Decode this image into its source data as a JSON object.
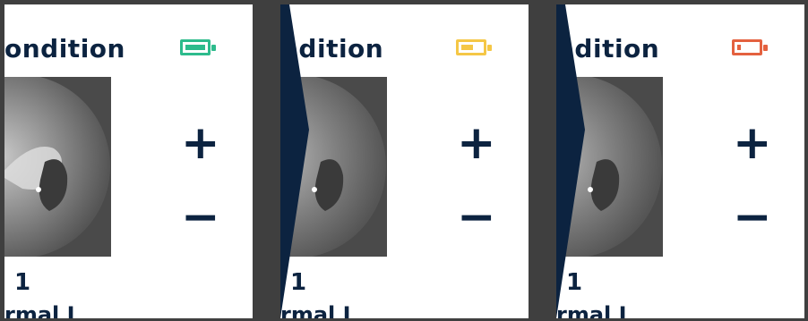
{
  "panels": [
    {
      "title": "ondition",
      "battery": {
        "color": "#2dbb8c",
        "level": 1.0
      },
      "plus_label": "+",
      "minus_label": "−",
      "number": "1",
      "subtitle": "rmal I"
    },
    {
      "title": "ndition",
      "battery": {
        "color": "#f5c746",
        "level": 0.55
      },
      "plus_label": "+",
      "minus_label": "−",
      "number": "1",
      "subtitle": "rmal I"
    },
    {
      "title": "ndition",
      "battery": {
        "color": "#e4613f",
        "level": 0.15
      },
      "plus_label": "+",
      "minus_label": "−",
      "number": "1",
      "subtitle": "rmal I"
    }
  ]
}
